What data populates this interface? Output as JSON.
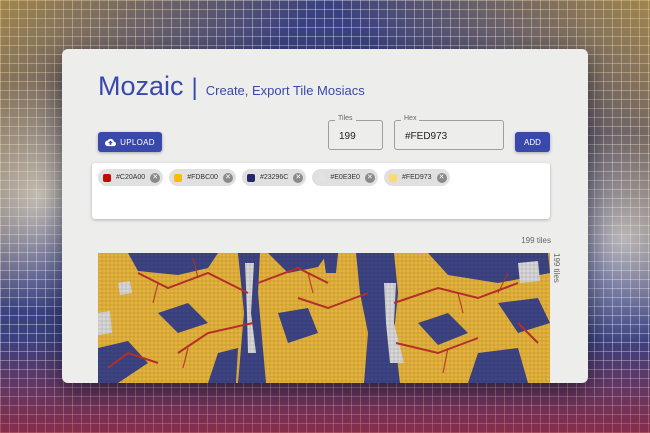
{
  "app": {
    "brand": "Mozaic",
    "separator": "|",
    "tagline": "Create, Export Tile Mosiacs"
  },
  "toolbar": {
    "upload_label": "UPLOAD",
    "upload_icon": "cloud-upload-icon",
    "add_label": "ADD"
  },
  "fields": {
    "tiles": {
      "label": "Tiles",
      "value": "199"
    },
    "hex": {
      "label": "Hex",
      "value": "#FED973"
    }
  },
  "palette": [
    {
      "code": "#C20A00",
      "color": "#C20A00"
    },
    {
      "code": "#FDBC00",
      "color": "#FDBC00"
    },
    {
      "code": "#23296C",
      "color": "#23296C"
    },
    {
      "code": "#E0E3E0",
      "color": "#E0E3E0"
    },
    {
      "code": "#FED973",
      "color": "#FED973"
    }
  ],
  "mosaic": {
    "tile_count_label": "199 tiles",
    "side_count_label": "199 tiles",
    "colors": {
      "background": "#e6b43c",
      "tree": "#3d4585",
      "sky": "#d8d8d8",
      "accent": "#c0302a"
    }
  }
}
